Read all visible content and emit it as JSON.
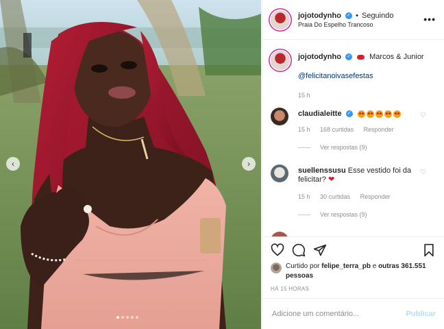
{
  "post": {
    "image_alt": "Photo of woman with long red hair in pink dress outdoors",
    "carousel": {
      "prev_icon": "chevron-left-icon",
      "next_icon": "chevron-right-icon",
      "dots": 5,
      "active_dot": 1
    }
  },
  "header": {
    "username": "jojotodynho",
    "separator": "•",
    "follow_status": "Seguindo",
    "location": "Praia Do Espelho Trancoso",
    "more_icon": "more-options-icon",
    "more_label": "•••"
  },
  "caption": {
    "username": "jojotodynho",
    "text": "Marcos & Junior",
    "mention": "@felicitanoivasefestas",
    "time": "15 h"
  },
  "comments": [
    {
      "username": "claudialeitte",
      "text": "",
      "emoji_count": 5,
      "time": "15 h",
      "likes": "168 curtidas",
      "reply": "Responder",
      "view_replies": "Ver respostas (9)"
    },
    {
      "username": "suellenssusu",
      "text": "Esse vestido foi da felicitar?",
      "time": "15 h",
      "likes": "30 curtidas",
      "reply": "Responder",
      "view_replies": "Ver respostas (9)"
    }
  ],
  "actions": {
    "like_icon": "heart-icon",
    "comment_icon": "comment-icon",
    "share_icon": "share-icon",
    "save_icon": "bookmark-icon"
  },
  "likes": {
    "prefix": "Curtido por",
    "user": "felipe_terra_pb",
    "and": "e",
    "others": "outras 361.551 pessoas"
  },
  "timestamp": "HÁ 15 HORAS",
  "comment_input": {
    "placeholder": "Adicione um comentário...",
    "publish_label": "Publicar"
  },
  "colors": {
    "verified": "#3897f0",
    "link": "#00376b",
    "muted": "#8e8e8e",
    "publish_disabled": "#b2dffc"
  }
}
